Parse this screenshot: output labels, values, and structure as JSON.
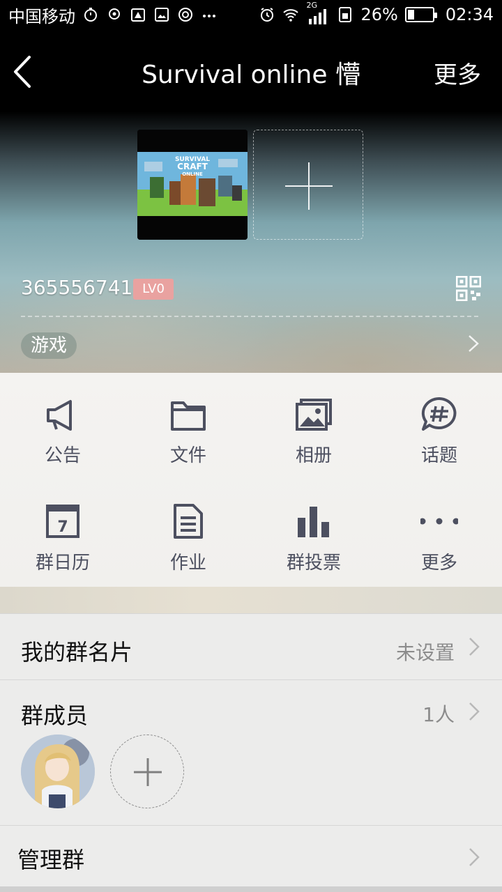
{
  "status_bar": {
    "carrier": "中国移动",
    "network_label": "2G",
    "battery_percent": "26%",
    "battery_level": 0.26,
    "time": "02:34"
  },
  "navbar": {
    "title": "Survival online 懵",
    "more_label": "更多"
  },
  "group_info": {
    "group_id": "365556741",
    "level": "LV0",
    "tag": "游戏",
    "cover_text_line1": "SURVIVAL",
    "cover_text_line2": "CRAFT",
    "cover_text_line3": "ONLINE"
  },
  "functions": [
    {
      "label": "公告",
      "icon": "megaphone-icon"
    },
    {
      "label": "文件",
      "icon": "folder-icon"
    },
    {
      "label": "相册",
      "icon": "photo-album-icon"
    },
    {
      "label": "话题",
      "icon": "topic-hashtag-icon"
    },
    {
      "label": "群日历",
      "icon": "calendar-icon",
      "calendar_day": "7"
    },
    {
      "label": "作业",
      "icon": "homework-document-icon"
    },
    {
      "label": "群投票",
      "icon": "vote-bar-chart-icon"
    },
    {
      "label": "更多",
      "icon": "more-dots-icon"
    }
  ],
  "list": {
    "card": {
      "title": "我的群名片",
      "value": "未设置"
    },
    "members": {
      "title": "群成员",
      "count": "1人"
    },
    "manage": {
      "title": "管理群"
    }
  },
  "colors": {
    "icon_color": "#4d5060",
    "level_badge": "#e9a2a0"
  }
}
